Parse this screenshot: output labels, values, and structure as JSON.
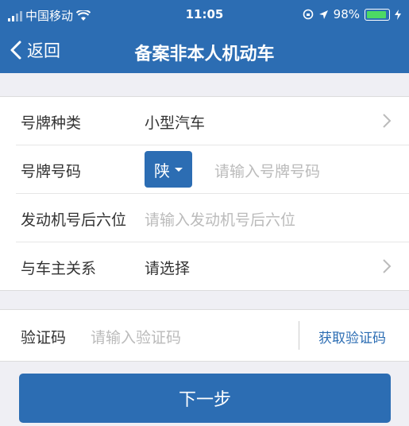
{
  "status_bar": {
    "carrier": "中国移动",
    "time": "11:05",
    "battery": "98%",
    "battery_level": 0.98
  },
  "nav": {
    "back_label": "返回",
    "title": "备案非本人机动车"
  },
  "form": {
    "plate_type": {
      "label": "号牌种类",
      "value": "小型汽车"
    },
    "plate_number": {
      "label": "号牌号码",
      "province": "陕",
      "placeholder": "请输入号牌号码"
    },
    "engine_number": {
      "label": "发动机号后六位",
      "placeholder": "请输入发动机号后六位"
    },
    "owner_relation": {
      "label": "与车主关系",
      "value": "请选择"
    }
  },
  "verification": {
    "label": "验证码",
    "placeholder": "请输入验证码",
    "get_code_label": "获取验证码"
  },
  "next_button": {
    "label": "下一步"
  },
  "colors": {
    "primary": "#2c6db3",
    "background": "#efeff4",
    "placeholder": "#bbbbbb",
    "battery": "#4cd964"
  }
}
